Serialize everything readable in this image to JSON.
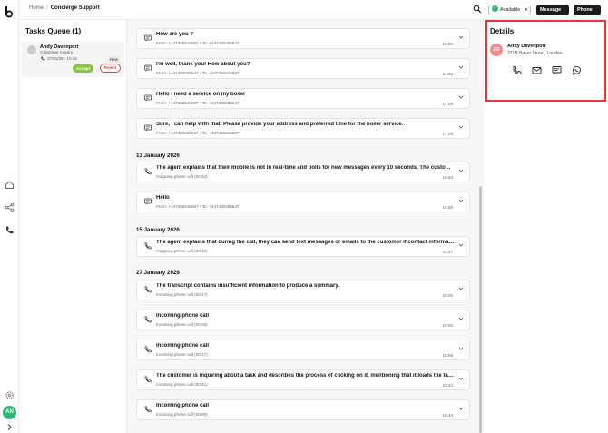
{
  "rail": {
    "avatar_initials": "AN",
    "icons": [
      "logo-icon",
      "home-icon",
      "share-icon",
      "phone-icon",
      "settings-icon",
      "expand-icon"
    ]
  },
  "topbar": {
    "breadcrumb": {
      "home": "Home",
      "separator": "/",
      "current": "Concierge Support"
    },
    "status": "Available",
    "message_button": "Message",
    "phone_button": "Phone"
  },
  "queue": {
    "title": "Tasks Queue (1)",
    "task": {
      "name": "Andy Davenport",
      "subject": "Customer inquiry",
      "time": "27/01/26 - 10:44",
      "badge": "New",
      "accept": "Accept",
      "reject": "Reject"
    }
  },
  "conversation": {
    "dates": [
      "13 January 2026",
      "15 January 2026",
      "27 January 2026"
    ],
    "items": [
      {
        "type": "message",
        "title": "How are you ?",
        "meta": "From: +447355616587  •  To: +447400298647",
        "time": "14:25"
      },
      {
        "type": "message",
        "title": "I'm well, thank you! How about you?",
        "meta": "From: +447400298647  •  To: +447355616587",
        "time": "14:25"
      },
      {
        "type": "message",
        "title": "Hello I need a service on my boiler",
        "meta": "From: +447355616587  •  To: +447400298647",
        "time": "17:08"
      },
      {
        "type": "message",
        "title": "Sure, I can help with that. Please provide your address and preferred time for the boiler service.",
        "meta": "From: +447400298647  •  To: +447355616587",
        "time": "17:08"
      },
      {
        "type": "call",
        "title": "The agent explains that their mobile is not in real-time and polls for new messages every 10 seconds. The customer confirms they received th…",
        "meta": "Outgoing phone call  (00:33)",
        "time": "16:53"
      },
      {
        "type": "message",
        "title": "Hello",
        "meta": "From: +447355616587  •  To: +447400298647",
        "time": "16:56"
      },
      {
        "type": "call",
        "title": "The agent explains that during the call, they can send text messages or emails to the customer if contact information is available.",
        "meta": "Outgoing phone call  (00:30)",
        "time": "10:37"
      },
      {
        "type": "call",
        "title": "The transcript contains insufficient information to produce a summary.",
        "meta": "Incoming phone call  (00:17)",
        "time": "10:05"
      },
      {
        "type": "call",
        "title": "Incoming phone call",
        "meta": "Incoming phone call  (00:02)",
        "time": "10:06"
      },
      {
        "type": "call",
        "title": "Incoming phone call",
        "meta": "Incoming phone call  (00:17)",
        "time": "10:06"
      },
      {
        "type": "call",
        "title": "The customer is inquiring about a task and describes the process of clicking on it, mentioning that it loads the task details.",
        "meta": "Incoming phone call  (00:21)",
        "time": "10:43"
      },
      {
        "type": "call",
        "title": "Incoming phone call",
        "meta": "Incoming phone call  (00:00)",
        "time": "10:44"
      }
    ]
  },
  "details": {
    "title": "Details",
    "initials": "AD",
    "name": "Andy Davenport",
    "address": "221B Baker Street, London",
    "actions": [
      "phone-icon",
      "email-icon",
      "sms-icon",
      "whatsapp-icon"
    ]
  },
  "colors": {
    "accent_green": "#2bb673",
    "accept_green": "#8ac33f",
    "reject_red": "#d84848",
    "highlight_red": "#e53a2e",
    "dark": "#1b1b1b",
    "avatar_pink": "#f28b8b"
  }
}
